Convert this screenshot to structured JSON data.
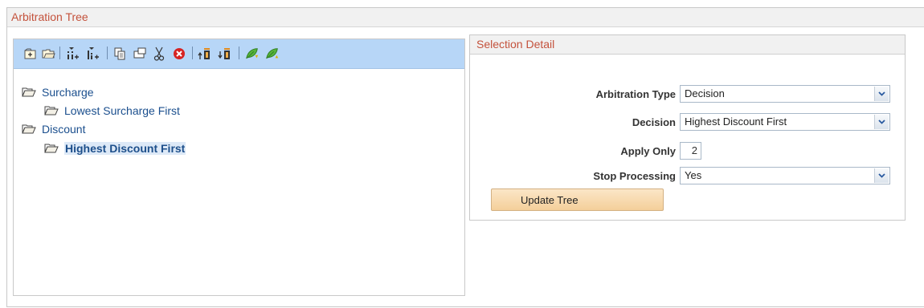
{
  "frame": {
    "title": "Arbitration Tree"
  },
  "toolbar": {
    "buttons": [
      {
        "icon": "add-sibling-folder-icon"
      },
      {
        "icon": "add-child-folder-icon"
      },
      {
        "icon": "insert-sibling-node-icon"
      },
      {
        "icon": "insert-child-node-icon"
      },
      {
        "icon": "copy-icon"
      },
      {
        "icon": "paste-icon"
      },
      {
        "icon": "cut-icon"
      },
      {
        "icon": "delete-icon"
      },
      {
        "icon": "move-up-icon"
      },
      {
        "icon": "move-down-icon"
      },
      {
        "icon": "expand-leaf-icon"
      },
      {
        "icon": "collapse-leaf-icon"
      }
    ]
  },
  "tree": {
    "nodes": [
      {
        "label": "Surcharge",
        "level": 0
      },
      {
        "label": "Lowest Surcharge First",
        "level": 1
      },
      {
        "label": "Discount",
        "level": 0
      },
      {
        "label": "Highest Discount First",
        "level": 1,
        "selected": true
      }
    ]
  },
  "detail": {
    "title": "Selection Detail",
    "arbitration_type": {
      "label": "Arbitration Type",
      "value": "Decision"
    },
    "decision": {
      "label": "Decision",
      "value": "Highest Discount First"
    },
    "apply_only": {
      "label": "Apply Only",
      "value": "2"
    },
    "stop_processing": {
      "label": "Stop Processing",
      "value": "Yes"
    },
    "update_button": "Update Tree"
  },
  "colors": {
    "header_text": "#c4523c",
    "toolbar_bg": "#b7d6f7",
    "tree_link": "#1b4f8e",
    "button_bg": "#f6d6a6"
  }
}
